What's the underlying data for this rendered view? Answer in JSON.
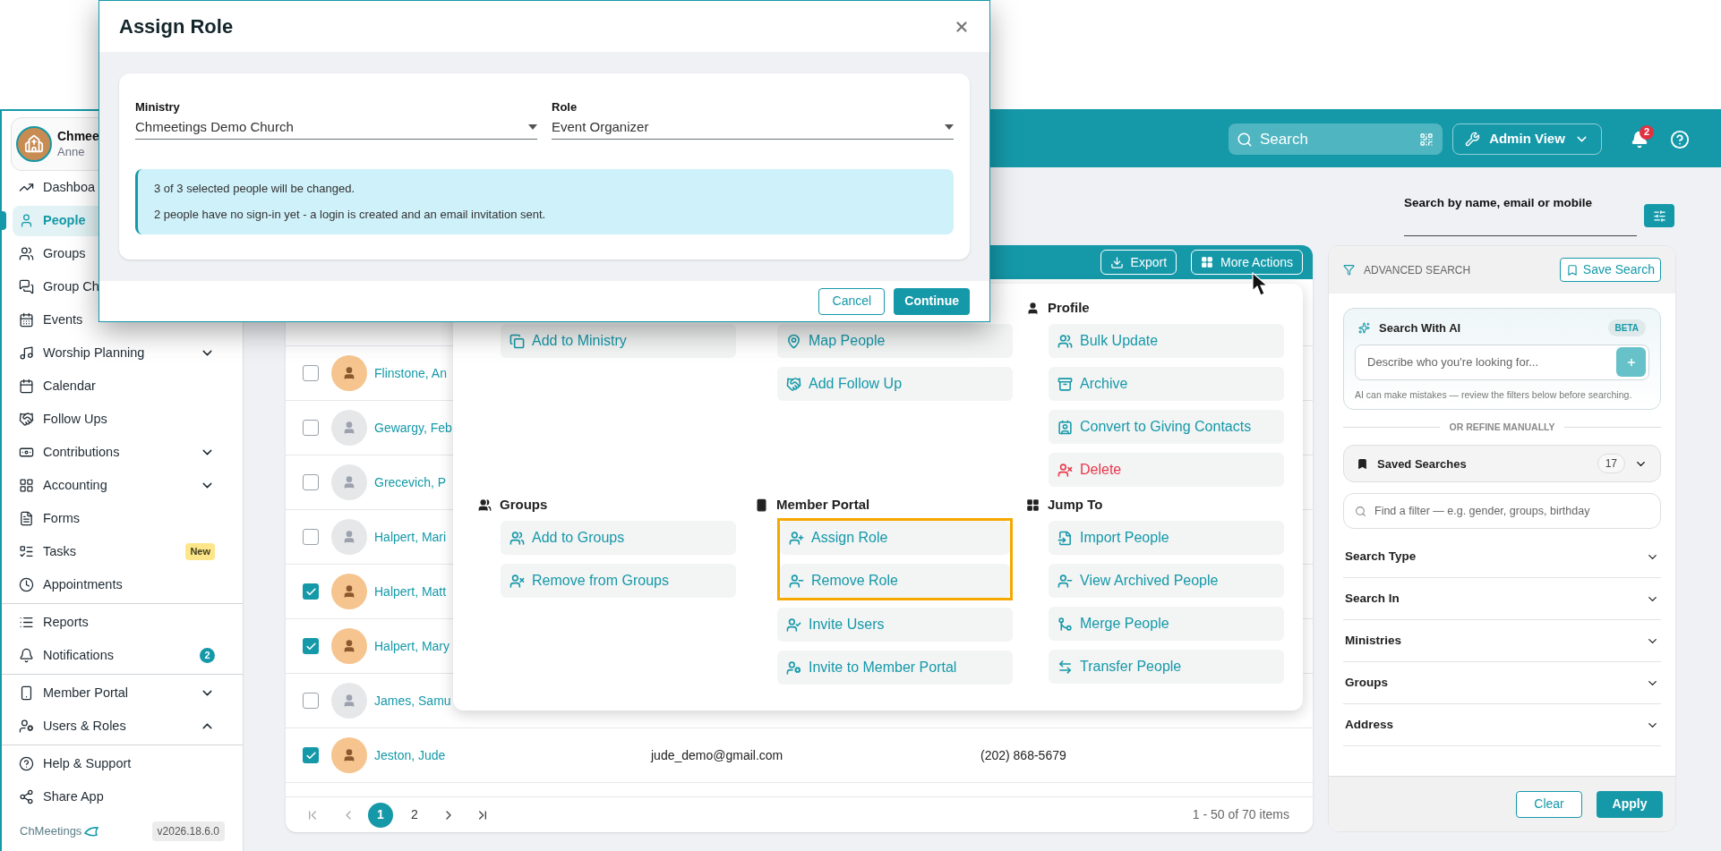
{
  "modal": {
    "title": "Assign Role",
    "fields": [
      {
        "label": "Ministry",
        "value": "Chmeetings Demo Church"
      },
      {
        "label": "Role",
        "value": "Event Organizer"
      }
    ],
    "info_lines": [
      "3 of 3 selected people will be changed.",
      "2 people have no sign-in yet - a login is created and an email invitation sent."
    ],
    "buttons": [
      {
        "label": "Cancel",
        "kind": "secondary"
      },
      {
        "label": "Continue",
        "kind": "primary"
      }
    ]
  },
  "sidebar": {
    "account": {
      "name": "Chmee",
      "user": "Anne"
    },
    "sections": [
      [
        {
          "label": "Dashboa",
          "kind": "link",
          "selected": false
        },
        {
          "label": "People",
          "kind": "link",
          "selected": true
        },
        {
          "label": "Groups",
          "kind": "link",
          "selected": false
        },
        {
          "label": "Group Ch",
          "kind": "link",
          "selected": false
        },
        {
          "label": "Events",
          "kind": "link",
          "selected": false
        },
        {
          "label": "Worship Planning",
          "kind": "group",
          "expanded": false,
          "selected": false
        },
        {
          "label": "Calendar",
          "kind": "link",
          "selected": false
        },
        {
          "label": "Follow Ups",
          "kind": "link",
          "selected": false
        },
        {
          "label": "Contributions",
          "kind": "group",
          "expanded": false,
          "selected": false
        },
        {
          "label": "Accounting",
          "kind": "group",
          "expanded": false,
          "selected": false
        },
        {
          "label": "Forms",
          "kind": "link",
          "selected": false
        },
        {
          "label": "Tasks",
          "kind": "link",
          "selected": false,
          "badge": {
            "text": "New",
            "kind": "new"
          }
        },
        {
          "label": "Appointments",
          "kind": "link",
          "selected": false
        }
      ],
      [
        {
          "label": "Reports",
          "kind": "link",
          "selected": false
        },
        {
          "label": "Notifications",
          "kind": "link",
          "selected": false,
          "badge": {
            "text": "2",
            "kind": "count"
          }
        }
      ],
      [
        {
          "label": "Member Portal",
          "kind": "group",
          "expanded": false,
          "selected": false
        },
        {
          "label": "Users & Roles",
          "kind": "group",
          "expanded": true,
          "selected": false
        }
      ],
      [
        {
          "label": "Help & Support",
          "kind": "link",
          "selected": false
        },
        {
          "label": "Share App",
          "kind": "link",
          "selected": false
        }
      ]
    ],
    "footer": {
      "brand": "ChMeetings",
      "version": "v2026.18.6.0"
    }
  },
  "header": {
    "search_placeholder": "Search",
    "admin_view": "Admin View",
    "notification_count": "2"
  },
  "people_search": {
    "label": "Search by name, email or mobile"
  },
  "table": {
    "toolbar": [
      "Export",
      "More Actions"
    ],
    "rows": [
      {
        "name": "Flinstone, An",
        "email": "",
        "phone": "",
        "checked": false,
        "has_picture": true
      },
      {
        "name": "Gewargy, Feb",
        "email": "",
        "phone": "",
        "checked": false,
        "has_picture": false
      },
      {
        "name": "Grecevich, P",
        "email": "",
        "phone": "",
        "checked": false,
        "has_picture": false
      },
      {
        "name": "Halpert, Mari",
        "email": "",
        "phone": "",
        "checked": false,
        "has_picture": false
      },
      {
        "name": "Halpert, Matt",
        "email": "",
        "phone": "",
        "checked": true,
        "has_picture": true
      },
      {
        "name": "Halpert, Mary",
        "email": "",
        "phone": "",
        "checked": true,
        "has_picture": true
      },
      {
        "name": "James, Samu",
        "email": "",
        "phone": "",
        "checked": false,
        "has_picture": false
      },
      {
        "name": "Jeston, Jude",
        "email": "jude_demo@gmail.com",
        "phone": "(202) 868-5679",
        "checked": true,
        "has_picture": true
      }
    ],
    "pagination": {
      "pages": [
        {
          "label": "1",
          "selected": true
        },
        {
          "label": "2",
          "selected": false
        }
      ],
      "summary": "1 - 50 of 70 items"
    }
  },
  "menu": {
    "sections": [
      {
        "items": [
          {
            "label": "Add to Ministry",
            "kind": "action",
            "highlighted": false
          }
        ]
      },
      {
        "items": [
          {
            "label": "Map People",
            "kind": "action",
            "highlighted": false
          },
          {
            "label": "Add Follow Up",
            "kind": "action",
            "highlighted": false
          }
        ]
      },
      {
        "title": "Profile",
        "items": [
          {
            "label": "Bulk Update",
            "kind": "action",
            "highlighted": false
          },
          {
            "label": "Archive",
            "kind": "action",
            "highlighted": false
          },
          {
            "label": "Convert to Giving Contacts",
            "kind": "action",
            "highlighted": false
          },
          {
            "label": "Delete",
            "kind": "danger",
            "highlighted": false
          }
        ]
      },
      {
        "title": "Groups",
        "items": [
          {
            "label": "Add to Groups",
            "kind": "action",
            "highlighted": false
          },
          {
            "label": "Remove from Groups",
            "kind": "action",
            "highlighted": false
          }
        ]
      },
      {
        "title": "Member Portal",
        "items": [
          {
            "label": "Assign Role",
            "kind": "action",
            "highlighted": true
          },
          {
            "label": "Remove Role",
            "kind": "action",
            "highlighted": true
          },
          {
            "label": "Invite Users",
            "kind": "action",
            "highlighted": false
          },
          {
            "label": "Invite to Member Portal",
            "kind": "action",
            "highlighted": false
          }
        ]
      },
      {
        "title": "Jump To",
        "items": [
          {
            "label": "Import People",
            "kind": "action",
            "highlighted": false
          },
          {
            "label": "View Archived People",
            "kind": "action",
            "highlighted": false
          },
          {
            "label": "Merge People",
            "kind": "action",
            "highlighted": false
          },
          {
            "label": "Transfer People",
            "kind": "action",
            "highlighted": false
          }
        ]
      }
    ]
  },
  "advanced_search": {
    "title": "ADVANCED SEARCH",
    "save_button": "Save Search",
    "ai": {
      "title": "Search With AI",
      "badge": "BETA",
      "placeholder": "Describe who you're looking for...",
      "note": "AI can make mistakes — review the filters below before searching."
    },
    "divider_label": "OR REFINE MANUALLY",
    "saved": {
      "label": "Saved Searches",
      "count": "17",
      "expanded": false
    },
    "filter_placeholder": "Find a filter — e.g. gender, groups, birthday",
    "filters": [
      {
        "label": "Search Type",
        "expanded": false
      },
      {
        "label": "Search In",
        "expanded": false
      },
      {
        "label": "Ministries",
        "expanded": false
      },
      {
        "label": "Groups",
        "expanded": false
      },
      {
        "label": "Address",
        "expanded": false
      }
    ],
    "buttons": [
      {
        "label": "Clear",
        "kind": "secondary"
      },
      {
        "label": "Apply",
        "kind": "primary"
      }
    ]
  }
}
